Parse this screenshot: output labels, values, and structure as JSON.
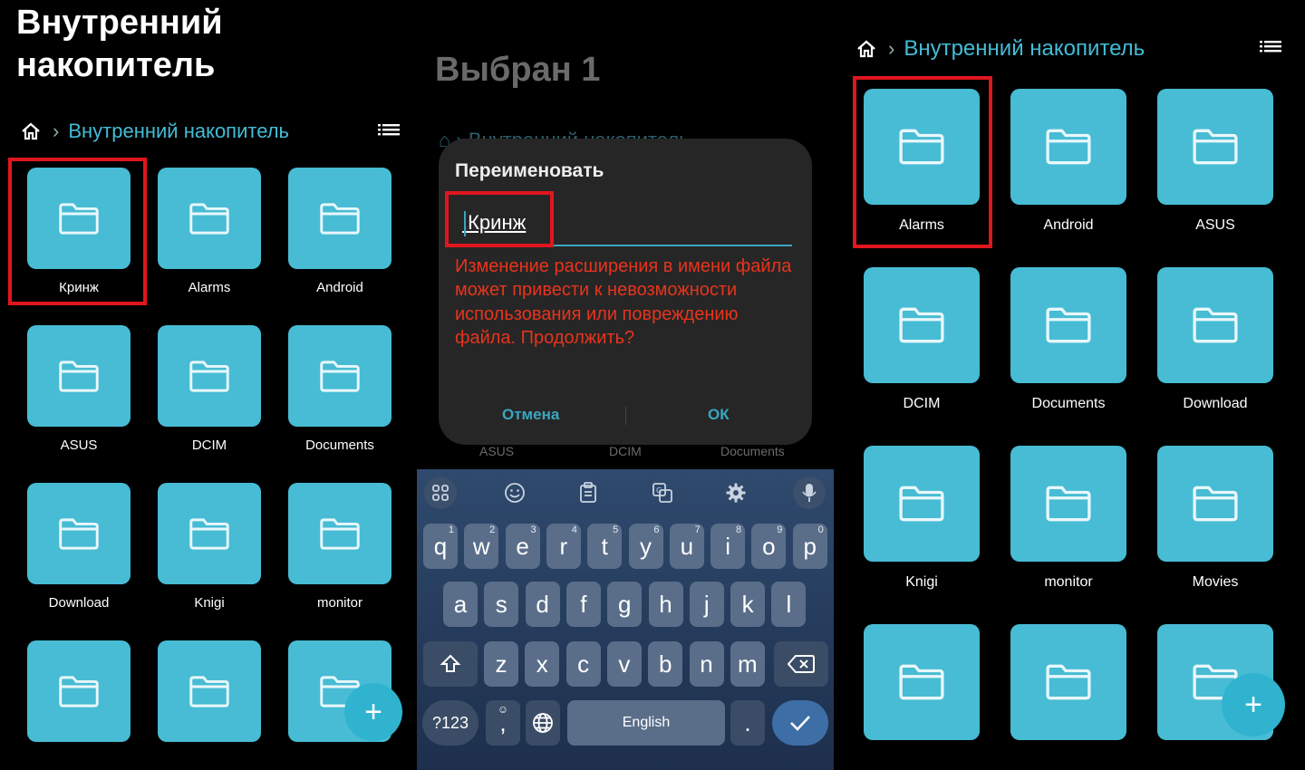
{
  "left": {
    "title_line1": "Внутренний",
    "title_line2": "накопитель",
    "breadcrumb": "Внутренний накопитель",
    "folders": [
      "Кринж",
      "Alarms",
      "Android",
      "ASUS",
      "DCIM",
      "Documents",
      "Download",
      "Knigi",
      "monitor",
      "",
      "",
      ""
    ],
    "fab": "+"
  },
  "middle": {
    "title": "Выбран 1",
    "breadcrumb": "Внутренний накопитель",
    "dialog": {
      "title": "Переименовать",
      "input_value": ".Кринж",
      "warning": "Изменение расширения в имени файла может привести к невозможности использования или повреждению файла. Продолжить?",
      "cancel": "Отмена",
      "ok": "ОК"
    },
    "under_labels": [
      "ASUS",
      "DCIM",
      "Documents"
    ],
    "keyboard": {
      "row1": [
        "q",
        "w",
        "e",
        "r",
        "t",
        "y",
        "u",
        "i",
        "o",
        "p"
      ],
      "row1_hints": [
        "1",
        "2",
        "3",
        "4",
        "5",
        "6",
        "7",
        "8",
        "9",
        "0"
      ],
      "row2": [
        "a",
        "s",
        "d",
        "f",
        "g",
        "h",
        "j",
        "k",
        "l"
      ],
      "row3": [
        "z",
        "x",
        "c",
        "v",
        "b",
        "n",
        "m"
      ],
      "symbols_key": "?123",
      "comma_key": ",",
      "space_label": "English",
      "period_key": "."
    }
  },
  "right": {
    "breadcrumb": "Внутренний накопитель",
    "folders": [
      "Alarms",
      "Android",
      "ASUS",
      "DCIM",
      "Documents",
      "Download",
      "Knigi",
      "monitor",
      "Movies",
      "",
      "",
      ""
    ],
    "fab": "+"
  },
  "colors": {
    "folder": "#47bcd4",
    "accent": "#43bcd6",
    "highlight": "#e0161e",
    "warning": "#e8341c"
  }
}
